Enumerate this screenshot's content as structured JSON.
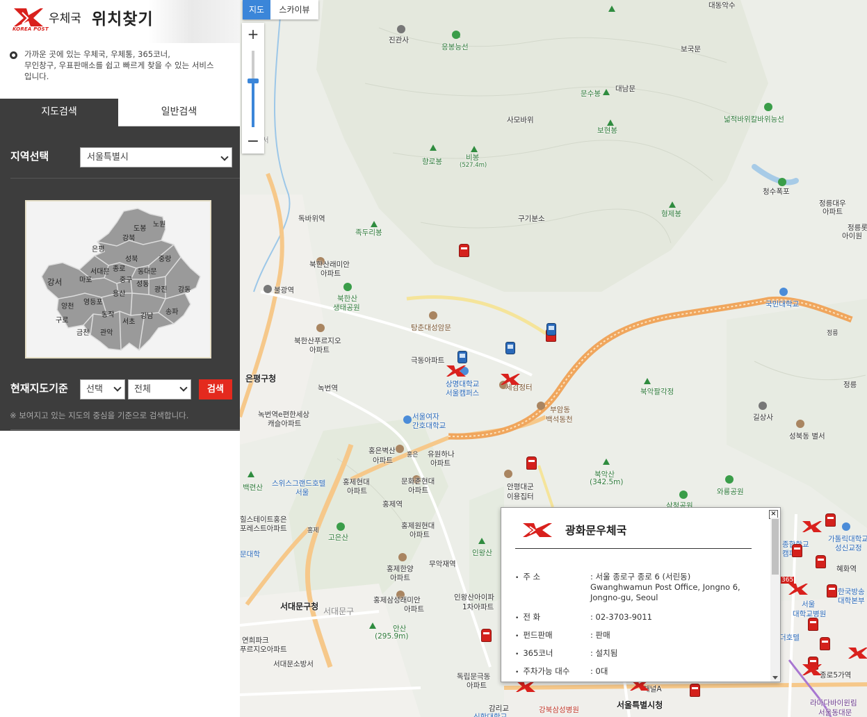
{
  "header": {
    "logo_text": "KOREA POST",
    "brand": "우체국",
    "title": "위치찾기"
  },
  "intro": {
    "line1": "가까운 곳에 있는 우체국, 우체통, 365코너,",
    "line2": "무인창구, 우표판매소를 쉽고 빠르게 찾을 수 있는 서비스",
    "line3": "입니다."
  },
  "tabs": {
    "map_search": "지도검색",
    "general_search": "일반검색"
  },
  "region": {
    "label": "지역선택",
    "selected": "서울특별시"
  },
  "districts": [
    "노원",
    "도봉",
    "강북",
    "은평",
    "성북",
    "중랑",
    "서대문",
    "종로",
    "동대문",
    "마포",
    "중구",
    "성동",
    "강서",
    "용산",
    "광진",
    "강동",
    "양천",
    "영등포",
    "동작",
    "송파",
    "구로",
    "서초",
    "강남",
    "금천",
    "관악"
  ],
  "current_map": {
    "label": "현재지도기준",
    "select1": "선택",
    "select2": "전체",
    "search_button": "검색",
    "note": "※ 보여지고 있는 지도의 중심을 기준으로 검색합니다."
  },
  "map": {
    "type_map": "지도",
    "type_sky": "스카이뷰",
    "zoom_in": "+",
    "zoom_out": "−",
    "labels": {
      "jingwansa": "진관사",
      "eungbong": "응봉능선",
      "daedong": "대동악수",
      "bogukmun": "보국문",
      "daenammun": "대남문",
      "munsubong": "문수봉",
      "samobawi": "사모바위",
      "bohyeonbong": "보현봉",
      "neolgeun": "넓적바위칼바위능선",
      "hyangrobong": "향로봉",
      "bibong": "비봉",
      "bibong_h": "(527.4m)",
      "cheongsu": "청수폭포",
      "jeongneung_apt": "정릉대우",
      "jeongneung_apt2": "아파트",
      "jeongneung_r": "정릉롯",
      "iwon": "아이원",
      "hyeongjebong": "형제봉",
      "gugibunso": "구기분소",
      "jokduri": "족두리봉",
      "dokbawi": "독바위역",
      "bukhansan_raemian": "북한산래미안",
      "bukhansan_raemian2": "아파트",
      "bukhansan_park": "북한산",
      "bukhansan_park2": "생태공원",
      "bulgwang": "불광역",
      "tangchun": "탕춘대성암문",
      "kookmin": "국민대학교",
      "jeongneung_ic": "정릉",
      "jeongneung2": "정릉",
      "bukhansan_pureun": "북한산푸르지오",
      "bukhansan_pureun2": "아파트",
      "eunpyeong_gu": "은평구청",
      "nokbeon": "녹번역",
      "geukdong": "극동아파트",
      "sangmyung": "상명대학교",
      "sangmyung2": "서울캠퍼스",
      "segeom": "세검정터",
      "bugak_palgak": "북악팔각정",
      "buam": "부암동",
      "buam2": "백석동천",
      "gilsangsa": "길상사",
      "seongbuk_byeol": "성북동 별서",
      "nokbeon_e": "녹번역e편한세상",
      "nokbeon_e2": "캐슬아파트",
      "seoul_women": "서울여자",
      "seoul_women2": "간호대학교",
      "hongeun_byeoksan": "홍은벽산",
      "hongeun_byeoksan2": "아파트",
      "hongeun_ic": "홍은",
      "yuwon": "유원하나",
      "yuwon2": "아파트",
      "bugaksan": "북악산",
      "bugaksan_h": "(342.5m)",
      "baengnyeon": "백련산",
      "swiss_grand": "스위스그랜드호텔",
      "seoul_s": "서울",
      "hongje_hyundai": "홍제현대",
      "hongje_hyundai2": "아파트",
      "munhwachon": "문화촌현대",
      "munhwachon2": "아파트",
      "anpyeong": "안평대군",
      "anpyeong2": "이용집터",
      "waryong": "와룡공원",
      "hongje_station": "홍제역",
      "hill_state": "힐스테이트홍은",
      "hill_state2": "포레스트아파트",
      "hongje_ic": "홍제",
      "goeunsan": "고은산",
      "hongje_won": "홍제원현대",
      "hongje_won2": "아파트",
      "inwangsan": "인왕산",
      "munhwa": "문대학",
      "muakjae": "무악재역",
      "hongje_hanyang": "홍제한양",
      "hongje_hanyang2": "아파트",
      "hongje_samsung": "홍제삼성래미안",
      "hongje_samsung2": "아파트",
      "inwangsan_ipark": "인왕산아이파",
      "inwangsan_ipark2": "1차아파트",
      "seodaemun_gu": "서대문구청",
      "seodaemun_gu2": "서대문구",
      "ansan": "안산",
      "ansan_h": "(295.9m)",
      "yeonhui": "연희파크",
      "yeonhui2": "푸르지오아파트",
      "seodaemun_fire": "서대문소방서",
      "dongnimmun": "독립문극동",
      "dongnimmun2": "아파트",
      "gamnigyo": "감리교",
      "gamnigyo2": "신학대학교",
      "gangbuk_samsung": "강북삼성병원",
      "seoul_city": "서울특별시청",
      "chaenel": "채널A",
      "seoul_univ_h": "서울",
      "seoul_univ_h2": "대학교병원",
      "catholic": "가톨릭대학교",
      "catholic2": "성신교정",
      "hyehwa": "혜화역",
      "kbs": "한국방송",
      "kbs2": "대학본부",
      "ramada": "라마다바이윈림",
      "ramada2": "서울동대문",
      "jongno5": "종로5가역",
      "deo_hotel": "더호텔",
      "jonghap": "종합학교",
      "kids": "캠퍼스",
      "num365": "365",
      "sams": "삼청공원",
      "seo": "서"
    }
  },
  "info": {
    "close": "×",
    "title": "광화문우체국",
    "address_label": "주 소",
    "address_value": ": 서울 종로구 종로 6 (서린동) Gwanghwamun Post Office, Jongno 6, Jongno-gu, Seoul",
    "phone_label": "전 화",
    "phone_value": ": 02-3703-9011",
    "fund_label": "펀드판매",
    "fund_value": ": 판매",
    "corner_label": "365코너",
    "corner_value": ": 설치됨",
    "parking_label": "주차가능 대수",
    "parking_value": ": 0대"
  },
  "colors": {
    "accent_red": "#e42a1e",
    "panel_dark": "#3d3d3d",
    "map_blue": "#3b86d9"
  }
}
